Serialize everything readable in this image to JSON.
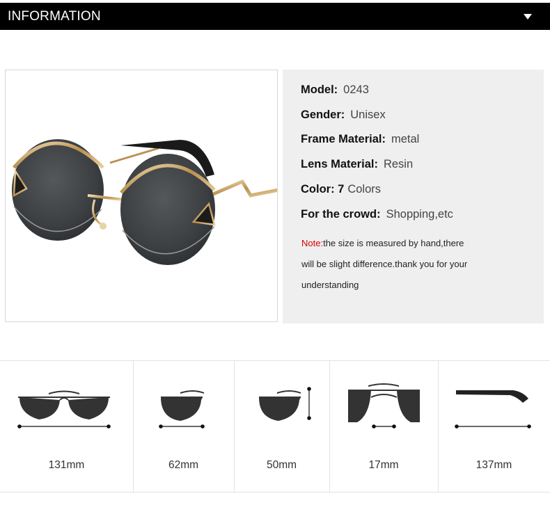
{
  "header": {
    "title": "INFORMATION",
    "toggle_icon": "caret-down-icon"
  },
  "product_image": {
    "alt": "round mirror sunglasses",
    "icon": "sunglasses-photo"
  },
  "specs": [
    {
      "label": "Model:",
      "value": "0243"
    },
    {
      "label": "Gender:",
      "value": "Unisex"
    },
    {
      "label": "Frame Material:",
      "value": "metal"
    },
    {
      "label": "Lens Material:",
      "value": "Resin"
    },
    {
      "label": "Color: 7",
      "value": "Colors"
    },
    {
      "label": "For the crowd:",
      "value": "Shopping,etc"
    }
  ],
  "note": {
    "prefix": "Note:",
    "line1": "the size is measured by hand,there",
    "line2": "will be slight difference.thank you for your",
    "line3": "understanding"
  },
  "dimensions": [
    {
      "value": "131mm",
      "icon": "total-width-icon"
    },
    {
      "value": "62mm",
      "icon": "lens-width-icon"
    },
    {
      "value": "50mm",
      "icon": "lens-height-icon"
    },
    {
      "value": "17mm",
      "icon": "bridge-width-icon"
    },
    {
      "value": "137mm",
      "icon": "temple-length-icon"
    }
  ],
  "colors": {
    "header_bg": "#000000",
    "spec_bg": "#efefef",
    "note_red": "#d40000"
  }
}
